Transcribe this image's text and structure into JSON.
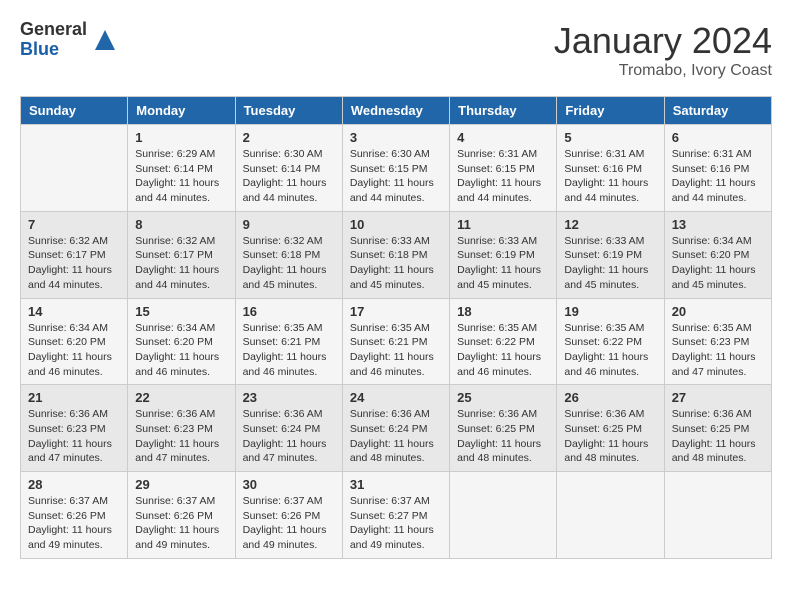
{
  "logo": {
    "general": "General",
    "blue": "Blue"
  },
  "title": "January 2024",
  "location": "Tromabo, Ivory Coast",
  "days_of_week": [
    "Sunday",
    "Monday",
    "Tuesday",
    "Wednesday",
    "Thursday",
    "Friday",
    "Saturday"
  ],
  "weeks": [
    [
      {
        "day": "",
        "sunrise": "",
        "sunset": "",
        "daylight": ""
      },
      {
        "day": "1",
        "sunrise": "Sunrise: 6:29 AM",
        "sunset": "Sunset: 6:14 PM",
        "daylight": "Daylight: 11 hours and 44 minutes."
      },
      {
        "day": "2",
        "sunrise": "Sunrise: 6:30 AM",
        "sunset": "Sunset: 6:14 PM",
        "daylight": "Daylight: 11 hours and 44 minutes."
      },
      {
        "day": "3",
        "sunrise": "Sunrise: 6:30 AM",
        "sunset": "Sunset: 6:15 PM",
        "daylight": "Daylight: 11 hours and 44 minutes."
      },
      {
        "day": "4",
        "sunrise": "Sunrise: 6:31 AM",
        "sunset": "Sunset: 6:15 PM",
        "daylight": "Daylight: 11 hours and 44 minutes."
      },
      {
        "day": "5",
        "sunrise": "Sunrise: 6:31 AM",
        "sunset": "Sunset: 6:16 PM",
        "daylight": "Daylight: 11 hours and 44 minutes."
      },
      {
        "day": "6",
        "sunrise": "Sunrise: 6:31 AM",
        "sunset": "Sunset: 6:16 PM",
        "daylight": "Daylight: 11 hours and 44 minutes."
      }
    ],
    [
      {
        "day": "7",
        "sunrise": "Sunrise: 6:32 AM",
        "sunset": "Sunset: 6:17 PM",
        "daylight": "Daylight: 11 hours and 44 minutes."
      },
      {
        "day": "8",
        "sunrise": "Sunrise: 6:32 AM",
        "sunset": "Sunset: 6:17 PM",
        "daylight": "Daylight: 11 hours and 44 minutes."
      },
      {
        "day": "9",
        "sunrise": "Sunrise: 6:32 AM",
        "sunset": "Sunset: 6:18 PM",
        "daylight": "Daylight: 11 hours and 45 minutes."
      },
      {
        "day": "10",
        "sunrise": "Sunrise: 6:33 AM",
        "sunset": "Sunset: 6:18 PM",
        "daylight": "Daylight: 11 hours and 45 minutes."
      },
      {
        "day": "11",
        "sunrise": "Sunrise: 6:33 AM",
        "sunset": "Sunset: 6:19 PM",
        "daylight": "Daylight: 11 hours and 45 minutes."
      },
      {
        "day": "12",
        "sunrise": "Sunrise: 6:33 AM",
        "sunset": "Sunset: 6:19 PM",
        "daylight": "Daylight: 11 hours and 45 minutes."
      },
      {
        "day": "13",
        "sunrise": "Sunrise: 6:34 AM",
        "sunset": "Sunset: 6:20 PM",
        "daylight": "Daylight: 11 hours and 45 minutes."
      }
    ],
    [
      {
        "day": "14",
        "sunrise": "Sunrise: 6:34 AM",
        "sunset": "Sunset: 6:20 PM",
        "daylight": "Daylight: 11 hours and 46 minutes."
      },
      {
        "day": "15",
        "sunrise": "Sunrise: 6:34 AM",
        "sunset": "Sunset: 6:20 PM",
        "daylight": "Daylight: 11 hours and 46 minutes."
      },
      {
        "day": "16",
        "sunrise": "Sunrise: 6:35 AM",
        "sunset": "Sunset: 6:21 PM",
        "daylight": "Daylight: 11 hours and 46 minutes."
      },
      {
        "day": "17",
        "sunrise": "Sunrise: 6:35 AM",
        "sunset": "Sunset: 6:21 PM",
        "daylight": "Daylight: 11 hours and 46 minutes."
      },
      {
        "day": "18",
        "sunrise": "Sunrise: 6:35 AM",
        "sunset": "Sunset: 6:22 PM",
        "daylight": "Daylight: 11 hours and 46 minutes."
      },
      {
        "day": "19",
        "sunrise": "Sunrise: 6:35 AM",
        "sunset": "Sunset: 6:22 PM",
        "daylight": "Daylight: 11 hours and 46 minutes."
      },
      {
        "day": "20",
        "sunrise": "Sunrise: 6:35 AM",
        "sunset": "Sunset: 6:23 PM",
        "daylight": "Daylight: 11 hours and 47 minutes."
      }
    ],
    [
      {
        "day": "21",
        "sunrise": "Sunrise: 6:36 AM",
        "sunset": "Sunset: 6:23 PM",
        "daylight": "Daylight: 11 hours and 47 minutes."
      },
      {
        "day": "22",
        "sunrise": "Sunrise: 6:36 AM",
        "sunset": "Sunset: 6:23 PM",
        "daylight": "Daylight: 11 hours and 47 minutes."
      },
      {
        "day": "23",
        "sunrise": "Sunrise: 6:36 AM",
        "sunset": "Sunset: 6:24 PM",
        "daylight": "Daylight: 11 hours and 47 minutes."
      },
      {
        "day": "24",
        "sunrise": "Sunrise: 6:36 AM",
        "sunset": "Sunset: 6:24 PM",
        "daylight": "Daylight: 11 hours and 48 minutes."
      },
      {
        "day": "25",
        "sunrise": "Sunrise: 6:36 AM",
        "sunset": "Sunset: 6:25 PM",
        "daylight": "Daylight: 11 hours and 48 minutes."
      },
      {
        "day": "26",
        "sunrise": "Sunrise: 6:36 AM",
        "sunset": "Sunset: 6:25 PM",
        "daylight": "Daylight: 11 hours and 48 minutes."
      },
      {
        "day": "27",
        "sunrise": "Sunrise: 6:36 AM",
        "sunset": "Sunset: 6:25 PM",
        "daylight": "Daylight: 11 hours and 48 minutes."
      }
    ],
    [
      {
        "day": "28",
        "sunrise": "Sunrise: 6:37 AM",
        "sunset": "Sunset: 6:26 PM",
        "daylight": "Daylight: 11 hours and 49 minutes."
      },
      {
        "day": "29",
        "sunrise": "Sunrise: 6:37 AM",
        "sunset": "Sunset: 6:26 PM",
        "daylight": "Daylight: 11 hours and 49 minutes."
      },
      {
        "day": "30",
        "sunrise": "Sunrise: 6:37 AM",
        "sunset": "Sunset: 6:26 PM",
        "daylight": "Daylight: 11 hours and 49 minutes."
      },
      {
        "day": "31",
        "sunrise": "Sunrise: 6:37 AM",
        "sunset": "Sunset: 6:27 PM",
        "daylight": "Daylight: 11 hours and 49 minutes."
      },
      {
        "day": "",
        "sunrise": "",
        "sunset": "",
        "daylight": ""
      },
      {
        "day": "",
        "sunrise": "",
        "sunset": "",
        "daylight": ""
      },
      {
        "day": "",
        "sunrise": "",
        "sunset": "",
        "daylight": ""
      }
    ]
  ]
}
